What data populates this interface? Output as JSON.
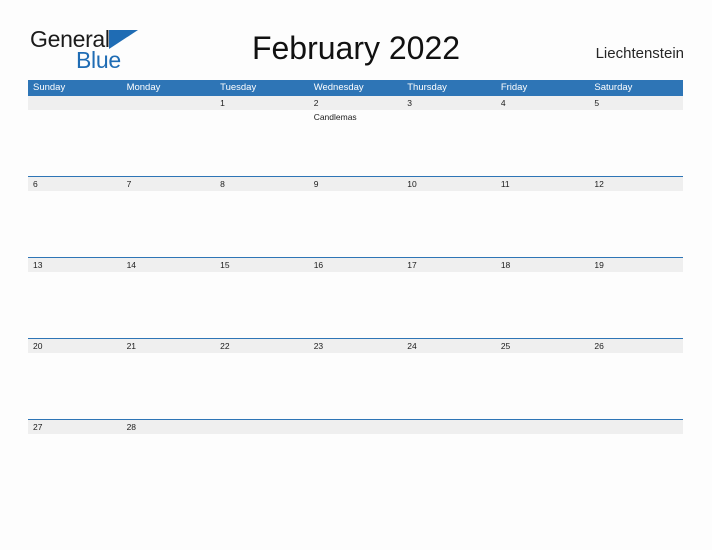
{
  "brand": {
    "name_part1": "General",
    "name_part2": "Blue",
    "color_primary": "#1f6cb4"
  },
  "header": {
    "title": "February 2022",
    "region": "Liechtenstein"
  },
  "calendar": {
    "month": "February",
    "year": "2022",
    "header_bg": "#2e75b6",
    "date_band_bg": "#efefef",
    "day_names": [
      "Sunday",
      "Monday",
      "Tuesday",
      "Wednesday",
      "Thursday",
      "Friday",
      "Saturday"
    ],
    "weeks": [
      {
        "days": [
          {
            "date": "",
            "events": []
          },
          {
            "date": "",
            "events": []
          },
          {
            "date": "1",
            "events": []
          },
          {
            "date": "2",
            "events": [
              "Candlemas"
            ]
          },
          {
            "date": "3",
            "events": []
          },
          {
            "date": "4",
            "events": []
          },
          {
            "date": "5",
            "events": []
          }
        ]
      },
      {
        "days": [
          {
            "date": "6",
            "events": []
          },
          {
            "date": "7",
            "events": []
          },
          {
            "date": "8",
            "events": []
          },
          {
            "date": "9",
            "events": []
          },
          {
            "date": "10",
            "events": []
          },
          {
            "date": "11",
            "events": []
          },
          {
            "date": "12",
            "events": []
          }
        ]
      },
      {
        "days": [
          {
            "date": "13",
            "events": []
          },
          {
            "date": "14",
            "events": []
          },
          {
            "date": "15",
            "events": []
          },
          {
            "date": "16",
            "events": []
          },
          {
            "date": "17",
            "events": []
          },
          {
            "date": "18",
            "events": []
          },
          {
            "date": "19",
            "events": []
          }
        ]
      },
      {
        "days": [
          {
            "date": "20",
            "events": []
          },
          {
            "date": "21",
            "events": []
          },
          {
            "date": "22",
            "events": []
          },
          {
            "date": "23",
            "events": []
          },
          {
            "date": "24",
            "events": []
          },
          {
            "date": "25",
            "events": []
          },
          {
            "date": "26",
            "events": []
          }
        ]
      },
      {
        "days": [
          {
            "date": "27",
            "events": []
          },
          {
            "date": "28",
            "events": []
          },
          {
            "date": "",
            "events": []
          },
          {
            "date": "",
            "events": []
          },
          {
            "date": "",
            "events": []
          },
          {
            "date": "",
            "events": []
          },
          {
            "date": "",
            "events": []
          }
        ]
      }
    ]
  }
}
